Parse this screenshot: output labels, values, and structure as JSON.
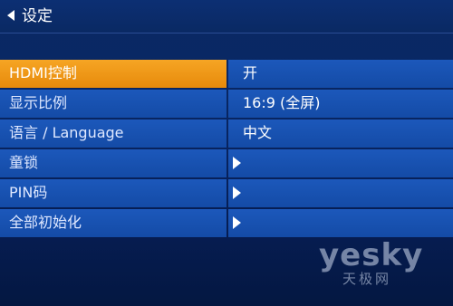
{
  "header": {
    "title": "设定"
  },
  "menu": {
    "items": [
      {
        "label": "HDMI控制",
        "value": "开",
        "has_arrow": false,
        "selected": true
      },
      {
        "label": "显示比例",
        "value": "16:9 (全屏)",
        "has_arrow": false,
        "selected": false
      },
      {
        "label": "语言 / Language",
        "value": "中文",
        "has_arrow": false,
        "selected": false
      },
      {
        "label": "童锁",
        "value": "",
        "has_arrow": true,
        "selected": false
      },
      {
        "label": "PIN码",
        "value": "",
        "has_arrow": true,
        "selected": false
      },
      {
        "label": "全部初始化",
        "value": "",
        "has_arrow": true,
        "selected": false
      }
    ]
  },
  "watermark": {
    "logo": "yesky",
    "sub": "天极网"
  },
  "colors": {
    "selected": "#f29a18",
    "row": "#1a54b5",
    "background": "#082460"
  },
  "icons": {
    "back": "back-triangle-icon",
    "submenu": "submenu-arrow-icon"
  }
}
